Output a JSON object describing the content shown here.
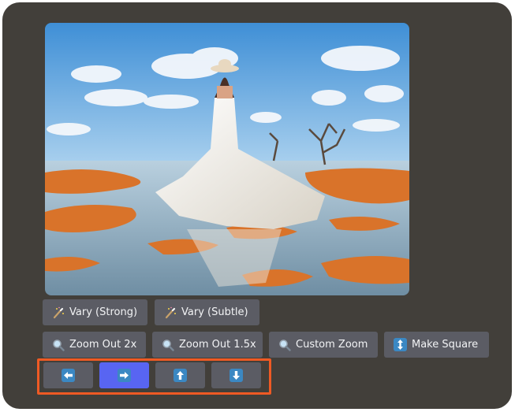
{
  "image": {
    "icon": "generated-image",
    "description_colors": {
      "sky": "#5aa3de",
      "water": "#8fb3c9",
      "rock": "#d9732a",
      "dress": "#f1ede6"
    }
  },
  "row1": [
    {
      "label": "Vary (Strong)",
      "icon": "magic-wand-icon"
    },
    {
      "label": "Vary (Subtle)",
      "icon": "magic-wand-icon"
    }
  ],
  "row2": [
    {
      "label": "Zoom Out 2x",
      "icon": "magnifier-icon"
    },
    {
      "label": "Zoom Out 1.5x",
      "icon": "magnifier-icon"
    },
    {
      "label": "Custom Zoom",
      "icon": "magnifier-icon"
    },
    {
      "label": "Make Square",
      "icon": "up-down-arrow-icon"
    }
  ],
  "row3": [
    {
      "icon": "arrow-left-icon",
      "active": false
    },
    {
      "icon": "arrow-right-icon",
      "active": true
    },
    {
      "icon": "arrow-up-icon",
      "active": false
    },
    {
      "icon": "arrow-down-icon",
      "active": false
    }
  ],
  "colors": {
    "panel": "#423f3a",
    "button": "#5b5c64",
    "button_active": "#5865f2",
    "highlight": "#ef5a24",
    "arrow_tile": "#3b88c3"
  }
}
